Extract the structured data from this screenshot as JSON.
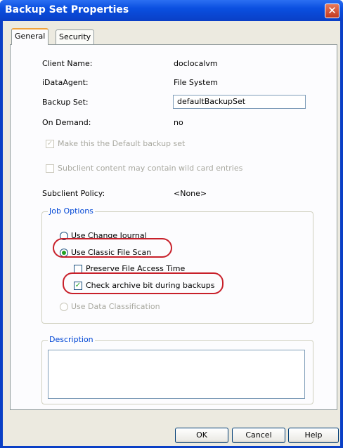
{
  "window": {
    "title": "Backup Set Properties",
    "close_glyph": "✕"
  },
  "tabs": [
    {
      "label": "General"
    },
    {
      "label": "Security"
    }
  ],
  "fields": {
    "client_name": {
      "label": "Client Name:",
      "value": "doclocalvm"
    },
    "idataagent": {
      "label": "iDataAgent:",
      "value": "File System"
    },
    "backup_set": {
      "label": "Backup Set:",
      "value": "defaultBackupSet"
    },
    "on_demand": {
      "label": "On Demand:",
      "value": "no"
    },
    "default_backup_set": {
      "label": "Make this the Default backup set",
      "checked": true,
      "disabled": true
    },
    "wildcard": {
      "label": "Subclient content may contain wild card entries",
      "checked": false,
      "disabled": true
    },
    "subclient_policy": {
      "label": "Subclient Policy:",
      "value": "<None>"
    }
  },
  "job_options": {
    "legend": "Job Options",
    "use_change_journal": {
      "label": "Use Change Journal",
      "selected": false
    },
    "use_classic_file_scan": {
      "label": "Use Classic File Scan",
      "selected": true
    },
    "preserve_file_access_time": {
      "label": "Preserve File Access Time",
      "checked": false
    },
    "check_archive_bit": {
      "label": "Check archive bit during backups",
      "checked": true
    },
    "use_data_classification": {
      "label": "Use Data Classification",
      "selected": false,
      "disabled": true
    }
  },
  "description": {
    "legend": "Description",
    "value": ""
  },
  "buttons": {
    "ok": "OK",
    "cancel": "Cancel",
    "help": "Help"
  },
  "colors": {
    "title_bar": "#0a3fc6",
    "highlight": "#c8202a",
    "check_mark": "#21a121",
    "legend_text": "#0046d5"
  }
}
